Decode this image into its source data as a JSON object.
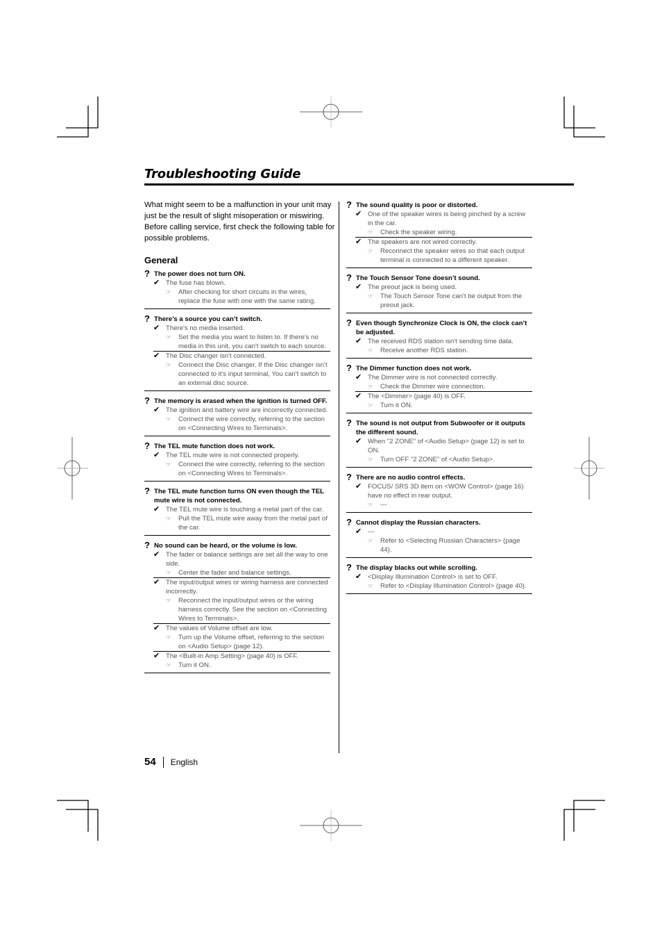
{
  "page": {
    "title": "Troubleshooting Guide",
    "intro": "What might seem to be a malfunction in your unit may just be the result of slight misoperation or miswiring. Before calling service, first check the following table for possible problems.",
    "section_heading": "General",
    "page_number": "54",
    "language": "English"
  },
  "icons": {
    "problem": "?",
    "cause": "✔",
    "remedy": "☞"
  },
  "left_column": [
    {
      "problem": "The power does not turn ON.",
      "causes": [
        {
          "cause": "The fuse has blown.",
          "remedy": "After checking for short circuits in the wires, replace the fuse with one with the same rating."
        }
      ]
    },
    {
      "problem": "There’s a source you can’t switch.",
      "causes": [
        {
          "cause": "There's no media inserted.",
          "remedy": "Set the media you want to listen to. If there's no media in this unit, you can't switch to each source."
        },
        {
          "cause": "The Disc changer isn't connected.",
          "remedy": "Connect the Disc changer. If the Disc changer isn't connected to it's input terminal, You can't switch to an external disc source."
        }
      ]
    },
    {
      "problem": "The memory is erased when the ignition is turned OFF.",
      "causes": [
        {
          "cause": "The ignition and battery wire are incorrectly connected.",
          "remedy": "Connect the wire correctly, referring to the section on <Connecting Wires to Terminals>."
        }
      ]
    },
    {
      "problem": "The TEL mute function does not work.",
      "causes": [
        {
          "cause": "The TEL mute wire is not connected properly.",
          "remedy": "Connect the wire correctly, referring to the section on <Connecting Wires to Terminals>."
        }
      ]
    },
    {
      "problem": "The TEL mute function turns ON even though the TEL mute wire is not connected.",
      "causes": [
        {
          "cause": "The TEL mute wire is touching a metal part of the car.",
          "remedy": "Pull the TEL mute wire away from the metal part of the car."
        }
      ]
    },
    {
      "problem": "No sound can be heard, or the volume is low.",
      "causes": [
        {
          "cause": "The fader or balance settings are set all the way to one side.",
          "remedy": "Center the fader and balance settings."
        },
        {
          "cause": "The input/output wires or wiring harness are connected incorrectly.",
          "remedy": "Reconnect the input/output wires or the wiring harness correctly. See the section on <Connecting Wires to Terminals>."
        },
        {
          "cause": "The values of Volume offset are low.",
          "remedy": "Turn up the Volume offset, referring to the section on <Audio Setup> (page 12)."
        },
        {
          "cause": "The <Built-in Amp Setting> (page 40) is OFF.",
          "remedy": "Turn it ON."
        }
      ]
    }
  ],
  "right_column": [
    {
      "problem": "The sound quality is poor or distorted.",
      "causes": [
        {
          "cause": "One of the speaker wires is being pinched by a screw in the car.",
          "remedy": "Check the speaker wiring."
        },
        {
          "cause": "The speakers are not wired correctly.",
          "remedy": "Reconnect the speaker wires so that each output terminal is connected to a different speaker."
        }
      ]
    },
    {
      "problem": "The Touch Sensor Tone doesn’t sound.",
      "causes": [
        {
          "cause": "The preout jack is being used.",
          "remedy": "The Touch Sensor Tone can't be output from the preout jack."
        }
      ]
    },
    {
      "problem": "Even though Synchronize Clock is ON, the clock can’t be adjusted.",
      "causes": [
        {
          "cause": "The received RDS station isn't sending time data.",
          "remedy": "Receive another RDS station."
        }
      ]
    },
    {
      "problem": "The Dimmer function does not work.",
      "causes": [
        {
          "cause": "The Dimmer wire is not connected correctly.",
          "remedy": "Check the Dimmer wire connection."
        },
        {
          "cause": "The <Dimmer> (page 40) is OFF.",
          "remedy": "Turn it ON."
        }
      ]
    },
    {
      "problem": "The sound is not output from Subwoofer or it outputs the different sound.",
      "causes": [
        {
          "cause": "When \"2 ZONE\" of <Audio Setup> (page 12) is set to ON.",
          "remedy": "Turn OFF \"2 ZONE\" of <Audio Setup>."
        }
      ]
    },
    {
      "problem": "There are no audio control effects.",
      "causes": [
        {
          "cause": "FOCUS/ SRS 3D item on <WOW Control> (page 16) have no effect in rear output.",
          "remedy": "---"
        }
      ]
    },
    {
      "problem": "Cannot display the Russian characters.",
      "causes": [
        {
          "cause": "---",
          "remedy": "Refer to <Selecting Russian Characters> (page 44)."
        }
      ]
    },
    {
      "problem": "The display blacks out while scrolling.",
      "causes": [
        {
          "cause": "<Display Illumination Control> is set to OFF.",
          "remedy": "Refer to <Display Illumination Control> (page 40)."
        }
      ]
    }
  ]
}
